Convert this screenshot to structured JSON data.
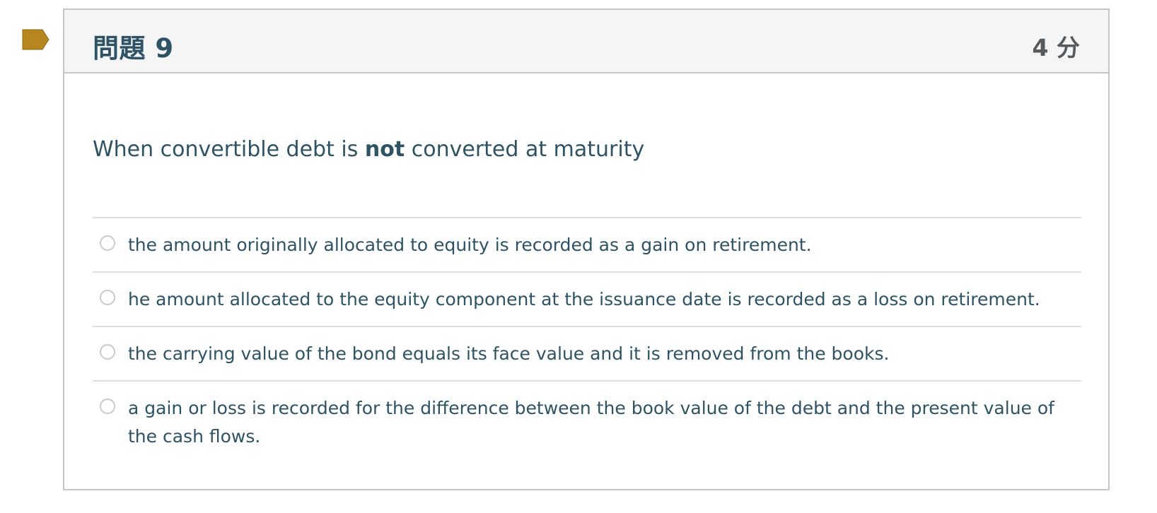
{
  "question": {
    "title": "問題 9",
    "points": "4 分",
    "text_before": "When convertible debt is ",
    "text_bold": "not",
    "text_after": " converted at maturity",
    "flag_color": "#b8861e"
  },
  "answers": [
    {
      "label": "the amount originally allocated to equity is recorded as a gain on retirement."
    },
    {
      "label": "he amount allocated to the equity component at the issuance date is recorded as a loss on retirement."
    },
    {
      "label": "the carrying value of the bond equals its face value and it is removed from the books."
    },
    {
      "label": "a gain or loss is recorded for the difference between the book value of the debt and the present value of the cash flows."
    }
  ]
}
